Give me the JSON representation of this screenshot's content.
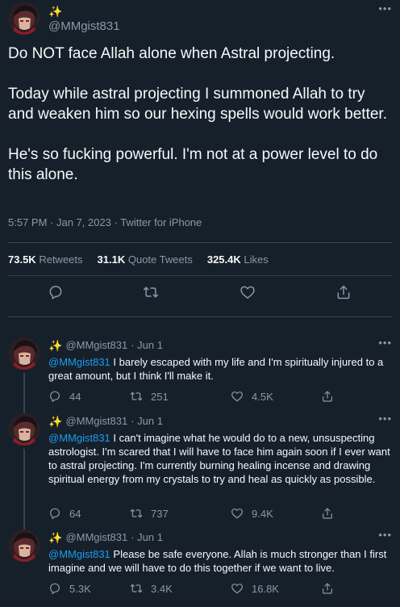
{
  "main_tweet": {
    "handle": "@MMgist831",
    "text": "Do NOT face Allah alone when Astral projecting.\n\nToday while astral projecting I summoned Allah to try and weaken him so our hexing spells would work better.\n\nHe's so fucking powerful. I'm not at a power level to do this alone.",
    "meta": "5:57 PM · Jan 7, 2023 · Twitter for iPhone",
    "stats": {
      "retweets_count": "73.5K",
      "retweets_label": "Retweets",
      "quotes_count": "31.1K",
      "quotes_label": "Quote Tweets",
      "likes_count": "325.4K",
      "likes_label": "Likes"
    }
  },
  "replies": [
    {
      "handle": "@MMgist831",
      "date": "· Jun 1",
      "mention": "@MMgist831",
      "text": "I barely escaped with my life and I'm spiritually injured to a great amount, but I think I'll make it.",
      "replies_count": "44",
      "retweets_count": "251",
      "likes_count": "4.5K"
    },
    {
      "handle": "@MMgist831",
      "date": "· Jun 1",
      "mention": "@MMgist831",
      "text": "I can't imagine what he would do to a new, unsuspecting astrologist. I'm scared that I will have to face him again soon if I ever want to astral projecting. I'm currently burning healing incense and drawing spiritual energy from my crystals to try and heal as quickly as possible.",
      "replies_count": "64",
      "retweets_count": "737",
      "likes_count": "9.4K"
    },
    {
      "handle": "@MMgist831",
      "date": "· Jun 1",
      "mention": "@MMgist831",
      "text": "Please be safe everyone. Allah is much stronger than I first imagine and we will have to do this together if we want to live.",
      "replies_count": "5.3K",
      "retweets_count": "3.4K",
      "likes_count": "16.8K"
    }
  ],
  "icons": {
    "sparkle": "sparkles-icon",
    "reply": "reply-icon",
    "retweet": "retweet-icon",
    "like": "heart-icon",
    "share": "share-icon",
    "more": "more-icon"
  },
  "colors": {
    "background": "#15202b",
    "text": "#f7f9f9",
    "muted": "#8b98a5",
    "link": "#1d9bf0",
    "border": "#38444d",
    "sparkle": "#f5c518"
  }
}
